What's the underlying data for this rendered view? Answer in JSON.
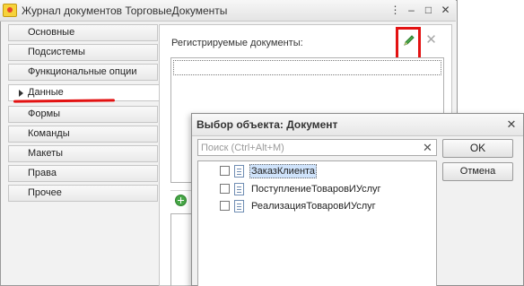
{
  "window": {
    "title": "Журнал документов ТорговыеДокументы",
    "controls": {
      "more": "⋮",
      "minimize": "–",
      "maximize": "□",
      "close": "✕"
    }
  },
  "sidebar": {
    "items": [
      {
        "label": "Основные",
        "active": false
      },
      {
        "label": "Подсистемы",
        "active": false
      },
      {
        "label": "Функциональные опции",
        "active": false
      },
      {
        "label": "Данные",
        "active": true
      },
      {
        "label": "Формы",
        "active": false
      },
      {
        "label": "Команды",
        "active": false
      },
      {
        "label": "Макеты",
        "active": false
      },
      {
        "label": "Права",
        "active": false
      },
      {
        "label": "Прочее",
        "active": false
      }
    ]
  },
  "content": {
    "registered_docs_label": "Регистрируемые документы:",
    "edit_icon": "pencil-icon",
    "delete_icon": "delete-x-icon",
    "delete_glyph": "✕",
    "add_icon": "add-circle-icon"
  },
  "dialog": {
    "title": "Выбор объекта: Документ",
    "close_glyph": "✕",
    "search_placeholder": "Поиск (Ctrl+Alt+M)",
    "search_clear_glyph": "✕",
    "ok_label": "OK",
    "cancel_label": "Отмена",
    "items": [
      {
        "label": "ЗаказКлиента",
        "checked": false,
        "selected": true
      },
      {
        "label": "ПоступлениеТоваровИУслуг",
        "checked": false,
        "selected": false
      },
      {
        "label": "РеализацияТоваровИУслуг",
        "checked": false,
        "selected": false
      }
    ]
  },
  "colors": {
    "highlight": "#e31212",
    "selection": "#cfe3fb",
    "pencil": "#2e8b2e"
  }
}
